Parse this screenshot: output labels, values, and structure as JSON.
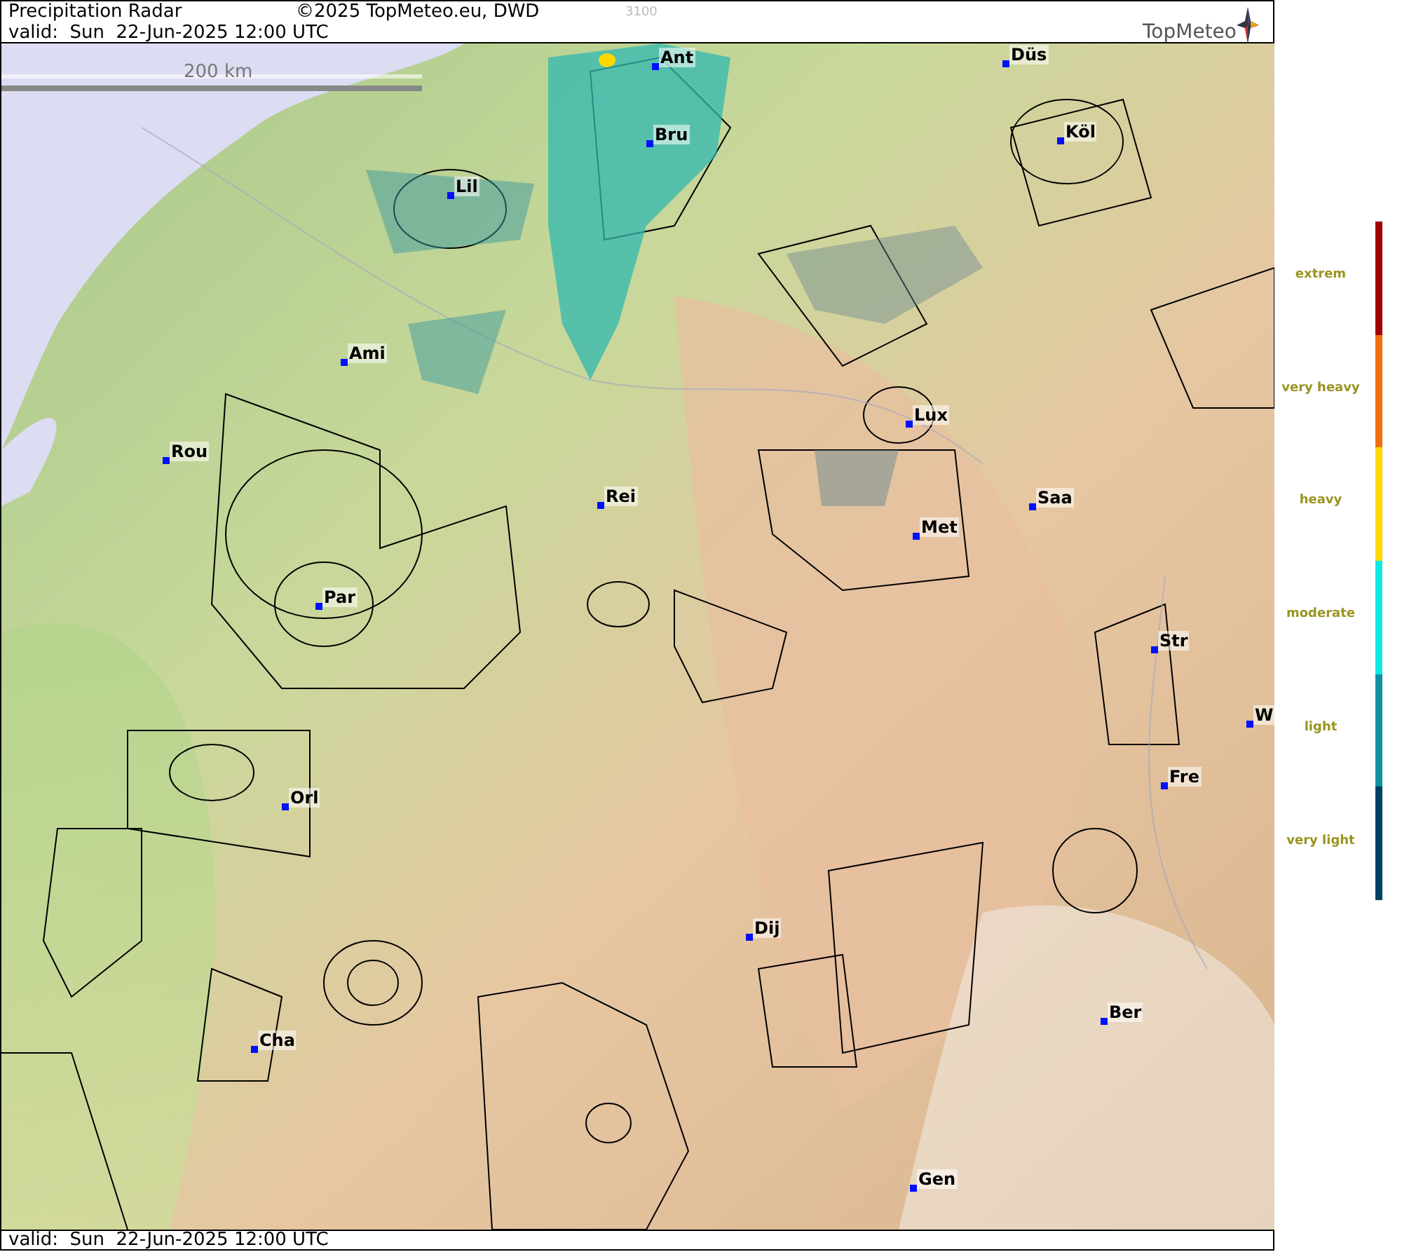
{
  "header": {
    "title": "Precipitation Radar",
    "copyright": "©2025 TopMeteo.eu, DWD",
    "code": "3100",
    "valid": "valid:  Sun  22-Jun-2025 12:00 UTC",
    "logo": "TopMeteo"
  },
  "map": {
    "scale": "200 km",
    "cities": [
      {
        "name": "Ant"
      },
      {
        "name": "Düs"
      },
      {
        "name": "Bru"
      },
      {
        "name": "Köl"
      },
      {
        "name": "Lil"
      },
      {
        "name": "Ami"
      },
      {
        "name": "Lux"
      },
      {
        "name": "Rou"
      },
      {
        "name": "Rei"
      },
      {
        "name": "Saa"
      },
      {
        "name": "Met"
      },
      {
        "name": "Par"
      },
      {
        "name": "Str"
      },
      {
        "name": "W"
      },
      {
        "name": "Fre"
      },
      {
        "name": "Orl"
      },
      {
        "name": "Dij"
      },
      {
        "name": "Ber"
      },
      {
        "name": "Cha"
      },
      {
        "name": "Gen"
      }
    ]
  },
  "legend": [
    {
      "label": "extrem",
      "color": "#a00000"
    },
    {
      "label": "very heavy",
      "color": "#f07010"
    },
    {
      "label": "heavy",
      "color": "#ffd800"
    },
    {
      "label": "moderate",
      "color": "#10e8e8"
    },
    {
      "label": "light",
      "color": "#1090a0"
    },
    {
      "label": "very light",
      "color": "#004060"
    }
  ],
  "footer": {
    "valid": "valid:  Sun  22-Jun-2025 12:00 UTC"
  }
}
